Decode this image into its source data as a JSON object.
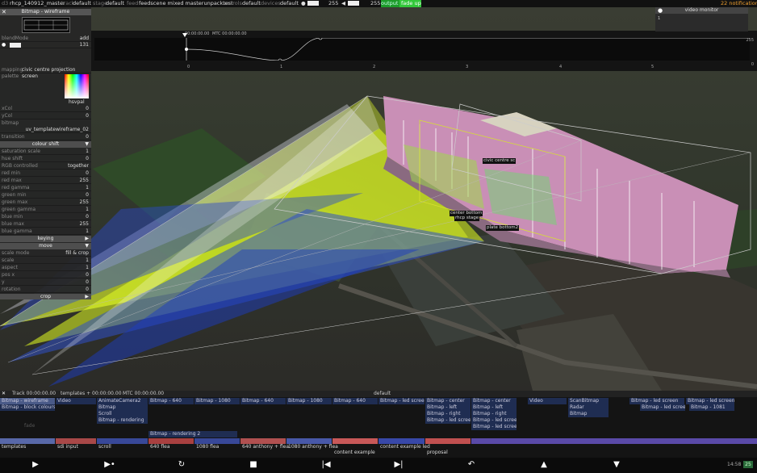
{
  "topbar": {
    "d3": "d3",
    "project": "rhcp_140912_master",
    "track_key": "track",
    "track_val": "default",
    "stage_key": "stage",
    "stage_val": "default",
    "feed_key": "feed",
    "feed_val": "feedscene mixed masterunpacktest",
    "controls_key": "controls",
    "controls_val": "default",
    "devices_key": "devices",
    "devices_val": "default",
    "level1": "255",
    "level2": "255",
    "output_label": "output",
    "fade_up": "fade up",
    "notifications": "22 notifications"
  },
  "panel": {
    "title": "Bitmap - wireframe",
    "blendmode_key": "blendMode",
    "blendmode_val": "add",
    "blend_num": "131",
    "mapping_key": "mapping",
    "mapping_val": "civic centre projection screen",
    "palette_key": "palette",
    "palette_name": "hsvpal",
    "xcol_key": "xCol",
    "xcol_val": "0",
    "ycol_key": "yCol",
    "ycol_val": "0",
    "bitmap_key": "bitmap",
    "bitmap_val": "uv_templatewireframe_02",
    "transition_key": "transition",
    "transition_val": "0",
    "colour_shift": "colour shift",
    "rows": [
      {
        "label": "saturation scale",
        "value": "1"
      },
      {
        "label": "hue shift",
        "value": "0"
      },
      {
        "label": "RGB controlled",
        "value": "together"
      },
      {
        "label": "red min",
        "value": "0"
      },
      {
        "label": "red max",
        "value": "255"
      },
      {
        "label": "red gamma",
        "value": "1"
      },
      {
        "label": "green min",
        "value": "0"
      },
      {
        "label": "green max",
        "value": "255"
      },
      {
        "label": "green gamma",
        "value": "1"
      },
      {
        "label": "blue min",
        "value": "0"
      },
      {
        "label": "blue max",
        "value": "255"
      },
      {
        "label": "blue gamma",
        "value": "1"
      }
    ],
    "keying": "keying",
    "move": "move",
    "move_rows": [
      {
        "label": "scale mode",
        "value": "fill & crop"
      },
      {
        "label": "scale",
        "value": "1"
      },
      {
        "label": "aspect",
        "value": "1"
      },
      {
        "label": "pos x",
        "value": "0"
      },
      {
        "label": "y",
        "value": "0"
      },
      {
        "label": "rotation",
        "value": "0"
      }
    ],
    "crop": "crop"
  },
  "timeline": {
    "timecode": "00:00:00.00",
    "mtc": "MTC 00:00:00.00",
    "ticks": [
      "0",
      "1",
      "2",
      "3",
      "4",
      "5"
    ],
    "max": "255",
    "min": "0"
  },
  "video_monitor": {
    "title": "video monitor",
    "value": "1"
  },
  "viewport_labels": {
    "civic": "civic centre sc",
    "center": "center bottom",
    "stage": "rhcp stage",
    "bottom2": "plate bottom2"
  },
  "bottom": {
    "track_label": "Track 00:00:00.00",
    "templates_label": "templates + 00:00:00.00",
    "mtc": "MTC 00:00:00.00",
    "default_label": "default",
    "clips": [
      "Bitmap - wireframe",
      "Video",
      "AnimateCamera2",
      "Bitmap - 640",
      "Bitmap - 1080",
      "Bitmap - 640",
      "Bitmap - 1080",
      "Bitmap - 640",
      "Bitmap - led screen",
      "Bitmap - center",
      "Bitmap - center",
      "Video",
      "ScanBitmap",
      "Bitmap - led screen",
      "Bitmap - led screen",
      "Bitmap - block colours",
      "Bitmap",
      "Scroll",
      "Bitmap - rendering",
      "Bitmap - left",
      "Bitmap - left",
      "Radar",
      "Bitmap - led screen",
      "Bitmap - 1081",
      "Bitmap - right",
      "Bitmap - right",
      "Bitmap",
      "Bitmap - led screen",
      "Bitmap - led screen",
      "Bitmap - led screen",
      "Bitmap - rendering 2",
      "fade"
    ],
    "section_labels": [
      "templates",
      "sdi input",
      "scroll",
      "640 flea",
      "1080 flea",
      "640 anthony + flea",
      "1080 anthony + flea",
      "content example led",
      "content example",
      "proposal"
    ],
    "time": "14:58",
    "time_badge": "25"
  }
}
